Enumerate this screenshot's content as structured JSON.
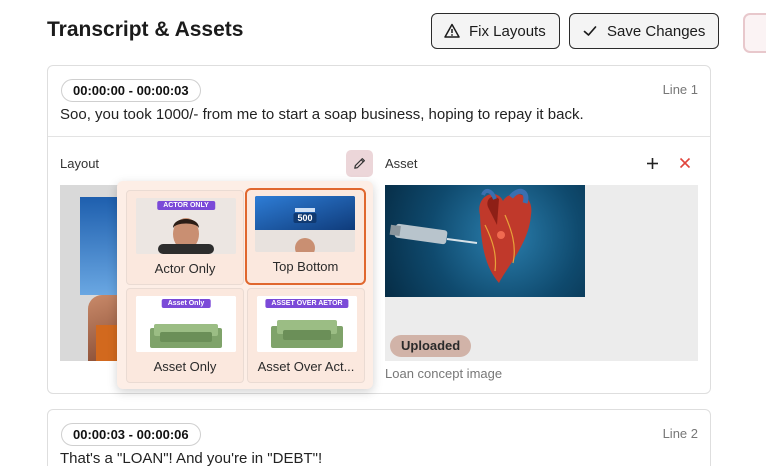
{
  "header": {
    "title": "Transcript & Assets",
    "fix_layouts_label": "Fix Layouts",
    "save_changes_label": "Save Changes"
  },
  "lines": [
    {
      "time": "00:00:00 - 00:00:03",
      "line_label": "Line 1",
      "text": "Soo, you took 1000/- from me to start a soap business, hoping to repay it back.",
      "layout_label": "Layout",
      "asset_label": "Asset",
      "asset_status": "Uploaded",
      "asset_caption": "Loan concept image"
    },
    {
      "time": "00:00:03 - 00:00:06",
      "line_label": "Line 2",
      "text": "That's a \"LOAN\"! And you're in \"DEBT\"!"
    }
  ],
  "layout_options": [
    {
      "name": "Actor Only",
      "tag": "ACTOR ONLY",
      "selected": false
    },
    {
      "name": "Top Bottom",
      "tag": "500",
      "selected": true
    },
    {
      "name": "Asset Only",
      "tag": "Asset Only",
      "selected": false
    },
    {
      "name": "Asset Over Act...",
      "tag": "ASSET OVER AETOR",
      "selected": false
    }
  ],
  "colors": {
    "accent_selected": "#e0672e",
    "popup_bg": "#fdeee6",
    "delete": "#e0443c",
    "uploaded_badge": "#d1b3a8",
    "tag_purple": "#7b4ad8"
  },
  "icons": {
    "fix_layouts": "warning-triangle-icon",
    "save_changes": "check-icon",
    "edit_layout": "pencil-icon",
    "add_asset": "plus-icon",
    "delete_asset": "close-icon"
  }
}
